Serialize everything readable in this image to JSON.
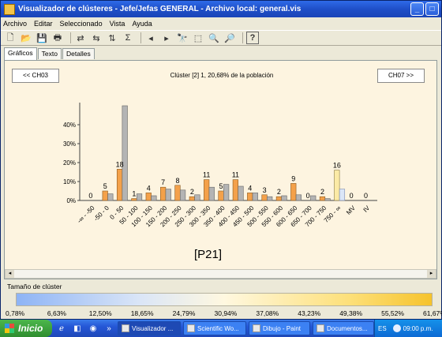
{
  "window": {
    "title": "Visualizador de clústeres - Jefe/Jefas GENERAL - Archivo local: general.vis",
    "min_label": "_",
    "max_label": "□",
    "close_label": "×"
  },
  "menu": [
    "Archivo",
    "Editar",
    "Seleccionado",
    "Vista",
    "Ayuda"
  ],
  "toolbar": [
    {
      "name": "new-icon",
      "glyph": "🗋"
    },
    {
      "name": "open-icon",
      "glyph": "📂"
    },
    {
      "name": "save-icon",
      "glyph": "💾"
    },
    {
      "name": "print-icon",
      "glyph": "🖶"
    },
    {
      "name": "swap-icon",
      "glyph": "⇄"
    },
    {
      "name": "swap-alt-icon",
      "glyph": "⇆"
    },
    {
      "name": "sort-icon",
      "glyph": "⇅"
    },
    {
      "name": "filter-icon",
      "glyph": "Σ"
    },
    {
      "name": "arrow-left-icon",
      "glyph": "◂"
    },
    {
      "name": "arrow-right-icon",
      "glyph": "▸"
    },
    {
      "name": "binoculars-icon",
      "glyph": "🔭"
    },
    {
      "name": "zoom-box-icon",
      "glyph": "⬚"
    },
    {
      "name": "zoom-in-icon",
      "glyph": "🔍"
    },
    {
      "name": "zoom-out-icon",
      "glyph": "🔎"
    },
    {
      "name": "help-icon",
      "glyph": "?"
    }
  ],
  "tabs": [
    "Gráficos",
    "Texto",
    "Detalles"
  ],
  "nav": {
    "prev": "<< CH03",
    "next": "CH07 >>"
  },
  "cluster_title": "Clúster [2] 1, 20,68% de la población",
  "chart_data": {
    "type": "bar",
    "y_ticks": [
      "40%",
      "30%",
      "20%",
      "10%",
      "0%"
    ],
    "y_tick_values": [
      40,
      30,
      20,
      10,
      0
    ],
    "ylim": [
      0,
      50
    ],
    "categories": [
      "-∞ - -50",
      "-50 - 0",
      "0 - 50",
      "50 - 100",
      "100 - 150",
      "150 - 200",
      "200 - 250",
      "250 - 300",
      "300 - 350",
      "350 - 400",
      "400 - 450",
      "450 - 500",
      "500 - 550",
      "550 - 600",
      "600 - 650",
      "650 - 700",
      "700 - 750",
      "750 - ∞",
      "MV",
      "IV"
    ],
    "series": [
      {
        "name": "cluster",
        "color": "#f4a14a",
        "values": [
          0,
          5,
          16.5,
          1,
          4,
          7,
          8,
          2,
          11,
          5,
          11,
          4,
          3,
          2,
          9,
          0,
          2,
          16,
          0,
          0
        ]
      },
      {
        "name": "population",
        "color": "#b4b4b4",
        "values": [
          0,
          3.5,
          50,
          3.5,
          2.5,
          6,
          5.5,
          3,
          7,
          8.5,
          7.5,
          4,
          2,
          2.5,
          3,
          2.5,
          1,
          6,
          0,
          0
        ]
      }
    ],
    "data_labels": [
      "0",
      "5",
      "18",
      "1",
      "4",
      "7",
      "8",
      "2",
      "11",
      "5",
      "11",
      "4",
      "3",
      "2",
      "9",
      "0",
      "2",
      "16",
      "0",
      "0"
    ]
  },
  "page_label": "[P21]",
  "legend": {
    "label": "Tamaño de clúster",
    "ticks": [
      "0,78%",
      "6,63%",
      "12,50%",
      "18,65%",
      "24,79%",
      "30,94%",
      "37,08%",
      "43,23%",
      "49,38%",
      "55,52%",
      "61,67%"
    ]
  },
  "taskbar": {
    "start": "Inicio",
    "quicklaunch": [
      {
        "name": "ie-icon",
        "glyph": "ℯ"
      },
      {
        "name": "desktop-icon",
        "glyph": "◧"
      },
      {
        "name": "firefox-icon",
        "glyph": "◉"
      },
      {
        "name": "more-icon",
        "glyph": "»"
      }
    ],
    "tasks": [
      "Visualizador ...",
      "Scientific Wo...",
      "Dibujo - Paint",
      "Documentos..."
    ],
    "tray": {
      "lang": "ES",
      "clock": "09:00 p.m."
    }
  }
}
